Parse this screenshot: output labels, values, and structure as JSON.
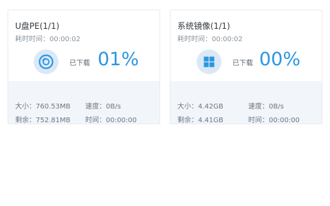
{
  "cards": [
    {
      "title": "U盘PE(1/1)",
      "elapsed": "耗时时间：00:00:02",
      "icon": "disc-icon",
      "progress_label": "已下载",
      "progress_text": "01%",
      "progress_value": 0.01,
      "size": "大小：760.53MB",
      "speed": "速度：0B/s",
      "remaining": "剩余：752.81MB",
      "time": "时间：00:00:00"
    },
    {
      "title": "系统镜像(1/1)",
      "elapsed": "耗时时间：00:00:02",
      "icon": "windows-icon",
      "progress_label": "已下载",
      "progress_text": "00%",
      "progress_value": 0.0,
      "size": "大小：4.42GB",
      "speed": "速度：0B/s",
      "remaining": "剩余：4.41GB",
      "time": "时间：00:00:00"
    }
  ],
  "colors": {
    "accent": "#2a96e2",
    "icon_bg": "#dbe9f7",
    "stats_bg": "#f2f6fa",
    "border": "#e6ebf0"
  }
}
